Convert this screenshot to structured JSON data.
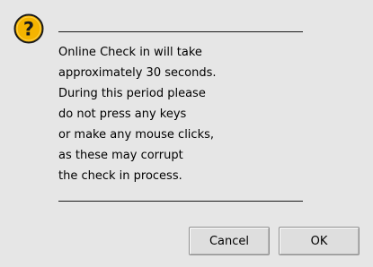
{
  "dialog": {
    "icon": "question-icon",
    "message_lines": [
      "Online Check in will take",
      "approximately 30 seconds.",
      "During this period please",
      "do not press any keys",
      "or make any mouse clicks,",
      "as these may corrupt",
      "the check in process."
    ],
    "cancel_label": "Cancel",
    "ok_label": "OK"
  },
  "colors": {
    "background": "#e6e6e6",
    "icon_fill": "#f5b400",
    "icon_outline": "#1a1a1a",
    "rule": "#1a1a1a",
    "button_face": "#dedede",
    "button_border": "#8e8e8e"
  }
}
